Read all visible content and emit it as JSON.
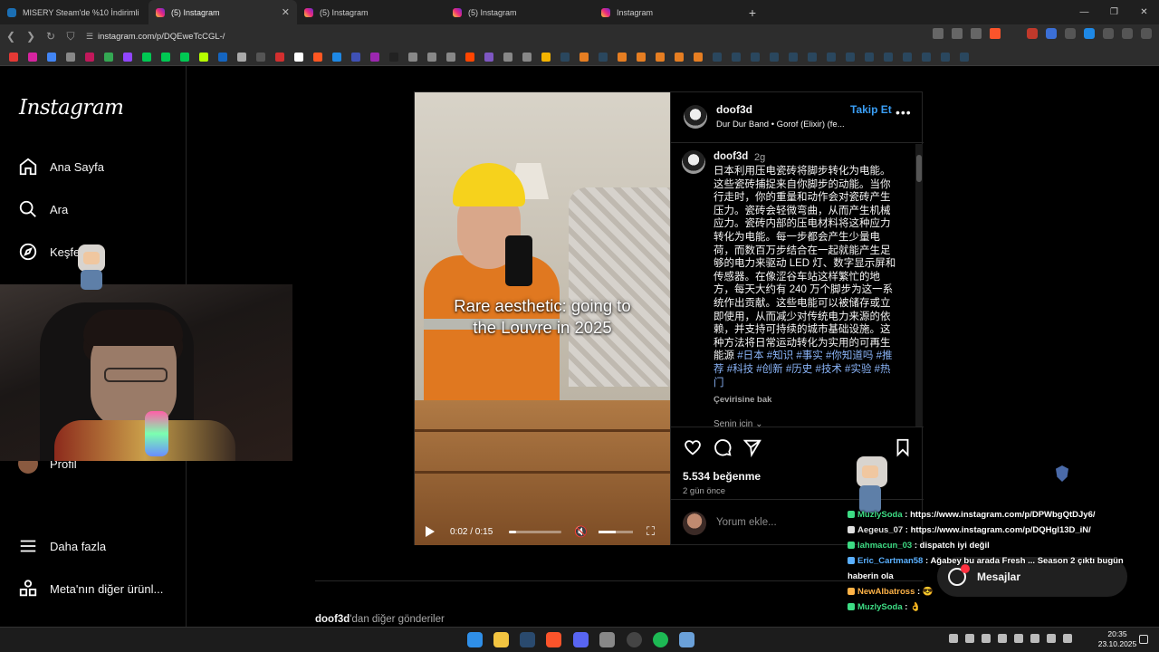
{
  "browser": {
    "tabs": [
      {
        "title": "MISERY Steam'de %10 İndirimli",
        "icon": "steam-icon",
        "active": false
      },
      {
        "title": "(5) Instagram",
        "icon": "instagram-icon",
        "active": true
      },
      {
        "title": "(5) Instagram",
        "icon": "instagram-icon",
        "active": false
      },
      {
        "title": "(5) Instagram",
        "icon": "instagram-icon",
        "active": false
      },
      {
        "title": "Instagram",
        "icon": "instagram-icon",
        "active": false
      }
    ],
    "new_tab": "+",
    "url": "instagram.com/p/DQEweTcCGL-/",
    "window_controls": {
      "minimize": "—",
      "maximize": "❐",
      "close": "✕"
    }
  },
  "sidebar": {
    "logo": "Instagram",
    "items": [
      {
        "label": "Ana Sayfa",
        "icon": "home-icon"
      },
      {
        "label": "Ara",
        "icon": "search-icon"
      },
      {
        "label": "Keşfet",
        "icon": "compass-icon"
      },
      {
        "label": "Profil",
        "icon": "profile-avatar"
      },
      {
        "label": "Daha fazla",
        "icon": "menu-icon"
      },
      {
        "label": "Meta'nın diğer ürünl...",
        "icon": "apps-icon"
      }
    ]
  },
  "post": {
    "video": {
      "overlay_text_line1": "Rare aesthetic: going to",
      "overlay_text_line2": "the Louvre in 2025",
      "time": "0:02 / 0:15",
      "progress": 0.13,
      "volume": 0.5
    },
    "header": {
      "username": "doof3d",
      "subtitle": "Dur Dur Band • Gorof (Elixir) (fe...",
      "follow": "Takip Et",
      "more": "•••"
    },
    "caption": {
      "username": "doof3d",
      "time": "2g",
      "text": "日本利用压电瓷砖将脚步转化为电能。这些瓷砖捕捉来自你脚步的动能。当你行走时，你的重量和动作会对瓷砖产生压力。瓷砖会轻微弯曲，从而产生机械应力。瓷砖内部的压电材料将这种应力转化为电能。每一步都会产生少量电荷，而数百万步结合在一起就能产生足够的电力来驱动 LED 灯、数字显示屏和传感器。在像涩谷车站这样繁忙的地方，每天大约有 240 万个脚步为这一系统作出贡献。这些电能可以被储存或立即使用，从而减少对传统电力来源的依赖，并支持可持续的城市基础设施。这种方法将日常运动转化为实用的可再生能源 ",
      "hashtags": "#日本 #知识 #事实 #你知道吗 #推荐 #科技 #创新 #历史 #技术 #实验 #热门",
      "translate": "Çevirisine bak",
      "for_you": "Senin için ⌄"
    },
    "likes": "5.534 beğenme",
    "ago": "2 gün önce",
    "comment_placeholder": "Yorum ekle..."
  },
  "more_posts": {
    "user": "doof3d",
    "suffix": "'dan diğer gönderiler"
  },
  "messages": {
    "label": "Mesajlar"
  },
  "stream_chat": [
    {
      "user": "MuzlySoda",
      "user_color": "#3ddc84",
      "text": " : https://www.instagram.com/p/DPWbgQtDJy6/"
    },
    {
      "user": "Aegeus_07",
      "user_color": "#e0e0e0",
      "text": " : https://www.instagram.com/p/DQHgl13D_iN/"
    },
    {
      "user": "lahmacun_03",
      "user_color": "#3ddc84",
      "text": " : dispatch iyi değil"
    },
    {
      "user": "Eric_Cartman58",
      "user_color": "#5ab0ff",
      "text": " : Ağabey bu arada Fresh ... Season 2 çıktı bugün"
    },
    {
      "user": "",
      "user_color": "#ffffff",
      "text": "haberin ola"
    },
    {
      "user": "NewAlbatross",
      "user_color": "#ffb347",
      "text": " : 😎"
    },
    {
      "user": "MuzlySoda",
      "user_color": "#3ddc84",
      "text": " : 👌"
    }
  ],
  "taskbar": {
    "time": "20:35",
    "date": "23.10.2025"
  },
  "colors": {
    "accent_blue": "#3a9ef5",
    "hashtag": "#8ab4f8",
    "background": "#000000"
  }
}
